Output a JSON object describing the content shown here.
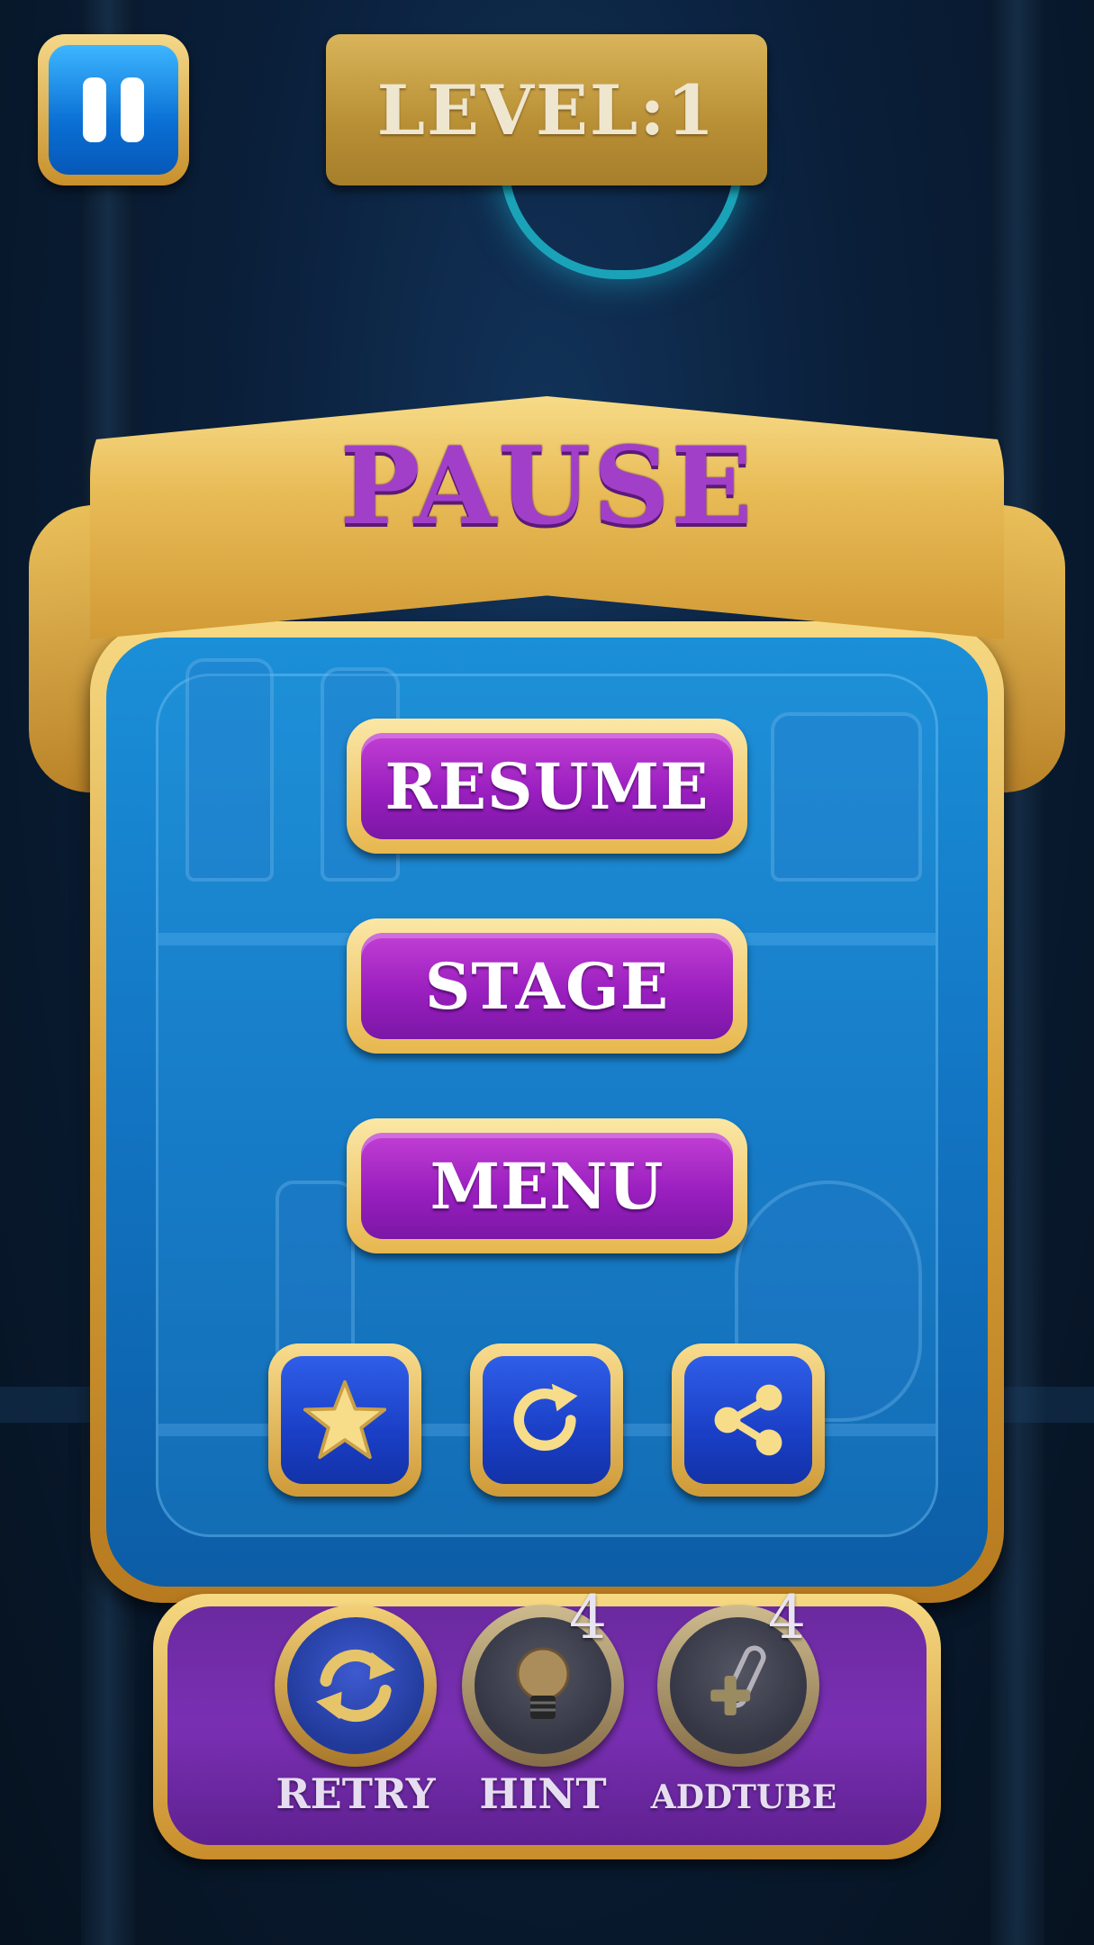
{
  "hud": {
    "level_text": "LEVEL:1"
  },
  "pause_panel": {
    "title": "PAUSE",
    "buttons": [
      "RESUME",
      "STAGE",
      "MENU"
    ],
    "icon_buttons": [
      "star-icon",
      "restart-icon",
      "share-icon"
    ]
  },
  "tray": {
    "items": [
      {
        "label": "RETRY",
        "icon": "retry-icon",
        "count": ""
      },
      {
        "label": "HINT",
        "icon": "lightbulb-icon",
        "count": "4"
      },
      {
        "label": "ADDTUBE",
        "icon": "add-tube-icon",
        "count": "4"
      }
    ]
  },
  "colors": {
    "gold": "#e8bb56",
    "purple": "#9a1fbf",
    "blue": "#1a3fc6",
    "title_purple": "#a23fc9"
  }
}
